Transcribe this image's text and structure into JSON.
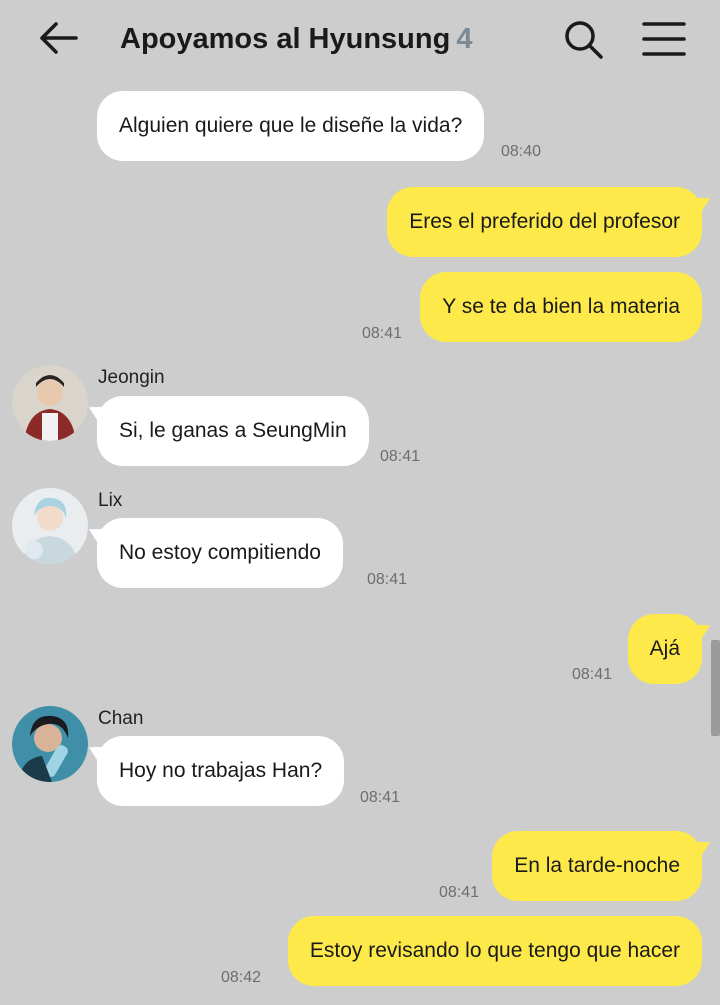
{
  "header": {
    "title": "Apoyamos al Hyunsung",
    "member_count": "4",
    "back_icon": "arrow-left-icon",
    "search_icon": "search-icon",
    "menu_icon": "hamburger-menu-icon"
  },
  "colors": {
    "background": "#cdcdcd",
    "outgoing_bubble": "#fee94a",
    "incoming_bubble": "#ffffff"
  },
  "messages": [
    {
      "direction": "in",
      "text": "Alguien quiere que le diseñe la vida?",
      "time": "08:40"
    },
    {
      "direction": "out",
      "text": "Eres el preferido del profesor"
    },
    {
      "direction": "out",
      "text": "Y se te da bien la materia",
      "time": "08:41"
    },
    {
      "direction": "in",
      "sender": "Jeongin",
      "text": "Si, le ganas a SeungMin",
      "time": "08:41"
    },
    {
      "direction": "in",
      "sender": "Lix",
      "text": "No estoy compitiendo",
      "time": "08:41"
    },
    {
      "direction": "out",
      "text": "Ajá",
      "time": "08:41"
    },
    {
      "direction": "in",
      "sender": "Chan",
      "text": "Hoy no trabajas Han?",
      "time": "08:41"
    },
    {
      "direction": "out",
      "text": "En la tarde-noche",
      "time": "08:41"
    },
    {
      "direction": "out",
      "text": "Estoy revisando lo que tengo que hacer",
      "time": "08:42"
    }
  ]
}
